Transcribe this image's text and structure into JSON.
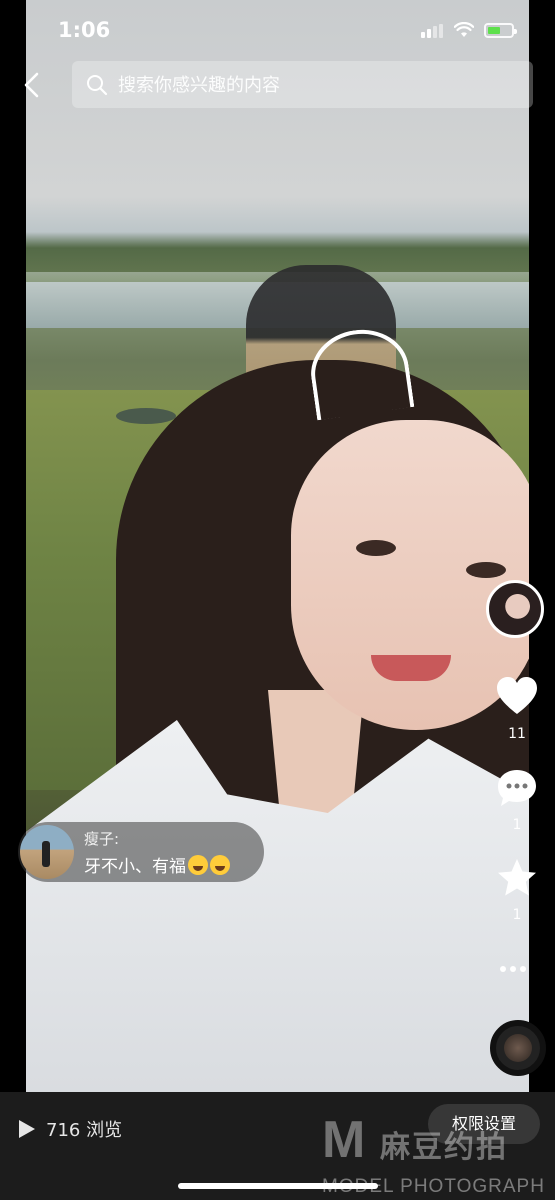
{
  "status_bar": {
    "time": "1:06"
  },
  "search": {
    "placeholder": "搜索你感兴趣的内容"
  },
  "icons": {
    "back": "chevron-left-icon",
    "search": "search-icon",
    "like": "heart-icon",
    "comment": "comment-icon",
    "favorite": "star-icon",
    "more": "more-dots-icon",
    "music": "music-disc-icon",
    "play": "play-icon"
  },
  "actions": {
    "like_count": "11",
    "comment_count": "1",
    "favorite_count": "1"
  },
  "comment": {
    "name": "瘦子:",
    "text": "牙不小、有福"
  },
  "bottom": {
    "views": "716 浏览",
    "permission_button": "权限设置"
  },
  "watermark": {
    "letter": "M",
    "chinese": "麻豆约拍",
    "english": "MODEL PHOTOGRAPH"
  },
  "colors": {
    "battery": "#5ee04c",
    "bottom_bar": "#1c1c1c"
  }
}
